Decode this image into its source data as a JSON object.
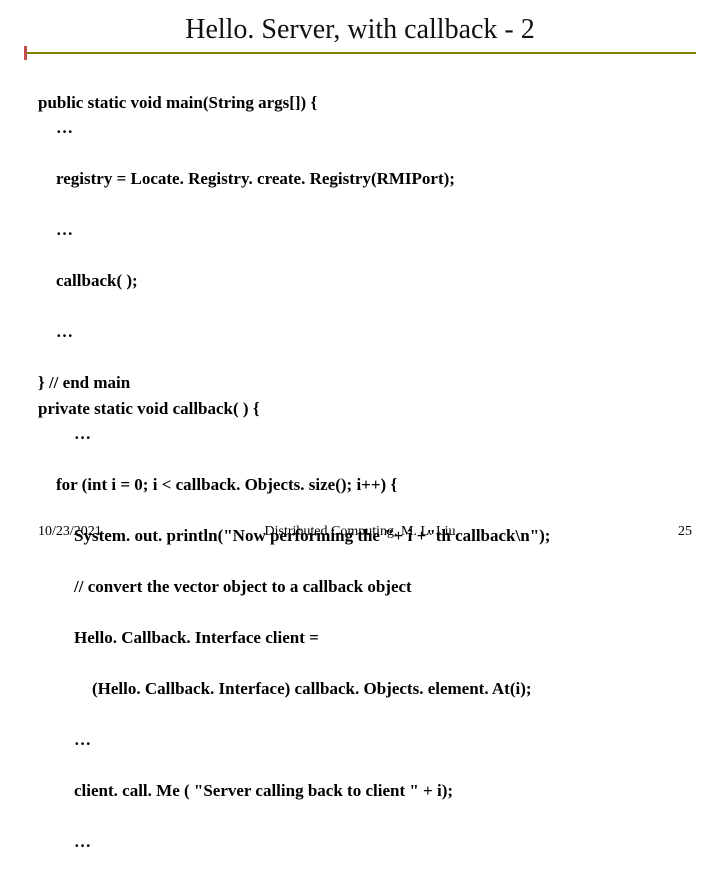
{
  "title": "Hello. Server, with callback - 2",
  "code": {
    "l1": "public static void main(String args[]) {",
    "l2": "…",
    "l3": "registry = Locate. Registry. create. Registry(RMIPort);",
    "l4": "…",
    "l5": "callback( );",
    "l6": "…",
    "l7": "} // end main",
    "l8": "private static void callback( ) {",
    "l9": "…",
    "l10": "for (int i = 0; i < callback. Objects. size(); i++) {",
    "l11": "System. out. println(\"Now performing the \"+ i +\"th callback\\n\");",
    "l12": "// convert the vector object to a callback object",
    "l13": "Hello. Callback. Interface client =",
    "l14": "(Hello. Callback. Interface) callback. Objects. element. At(i);",
    "l15": "…",
    "l16": "client. call. Me ( \"Server calling back to client \" + i);",
    "l17": "…"
  },
  "footer": {
    "date": "10/23/2021",
    "center": "Distributed Computing, M. L. Liu",
    "page": "25"
  }
}
